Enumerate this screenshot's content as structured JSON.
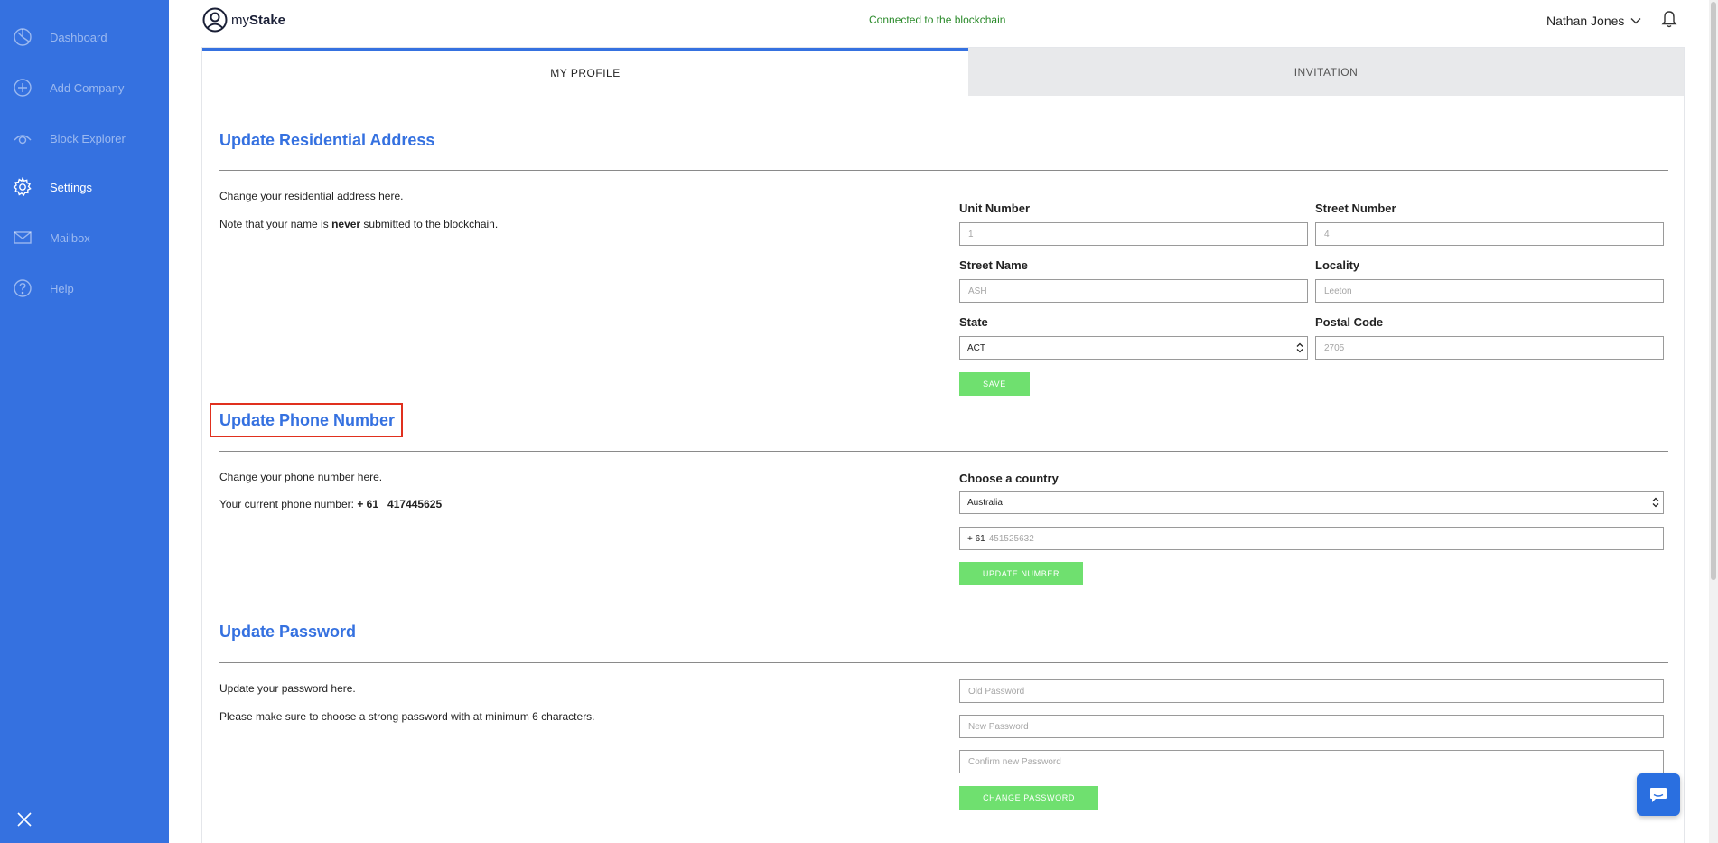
{
  "sidebar": {
    "items": [
      {
        "label": "Dashboard",
        "icon": "dashboard-icon",
        "active": false
      },
      {
        "label": "Add Company",
        "icon": "plus-circle-icon",
        "active": false
      },
      {
        "label": "Block Explorer",
        "icon": "eye-icon",
        "active": false
      },
      {
        "label": "Settings",
        "icon": "gear-icon",
        "active": true
      },
      {
        "label": "Mailbox",
        "icon": "mail-icon",
        "active": false
      },
      {
        "label": "Help",
        "icon": "help-icon",
        "active": false
      }
    ],
    "close_icon": "close-icon"
  },
  "header": {
    "logo_prefix": "my",
    "logo_bold": "Stake",
    "connection_status": "Connected to the blockchain",
    "user_name": "Nathan Jones"
  },
  "tabs": [
    {
      "label": "MY PROFILE",
      "active": true
    },
    {
      "label": "INVITATION",
      "active": false
    }
  ],
  "address": {
    "title": "Update Residential Address",
    "desc1": "Change your residential address here.",
    "note_before": "Note that your name is ",
    "note_bold": "never",
    "note_after": " submitted to the blockchain.",
    "unit_label": "Unit Number",
    "unit_placeholder": "1",
    "street_number_label": "Street Number",
    "street_number_placeholder": "4",
    "street_name_label": "Street Name",
    "street_name_placeholder": "ASH",
    "locality_label": "Locality",
    "locality_placeholder": "Leeton",
    "state_label": "State",
    "state_value": "ACT",
    "postal_label": "Postal Code",
    "postal_placeholder": "2705",
    "save_label": "SAVE"
  },
  "phone": {
    "title": "Update Phone Number",
    "desc1": "Change your phone number here.",
    "current_label": "Your current phone number: ",
    "current_code": "+ 61",
    "current_number": "417445625",
    "country_label": "Choose a country",
    "country_value": "Australia",
    "prefix": "+ 61",
    "number_placeholder": "451525632",
    "button_label": "UPDATE NUMBER"
  },
  "password": {
    "title": "Update Password",
    "desc1": "Update your password here.",
    "desc2": "Please make sure to choose a strong password with at minimum 6 characters.",
    "old_placeholder": "Old Password",
    "new_placeholder": "New Password",
    "confirm_placeholder": "Confirm new Password",
    "button_label": "CHANGE PASSWORD"
  },
  "colors": {
    "sidebar": "#3571e0",
    "accent": "#3571e0",
    "button": "#6fe06f",
    "status": "#2a8a2a",
    "highlight": "#e0301e"
  }
}
